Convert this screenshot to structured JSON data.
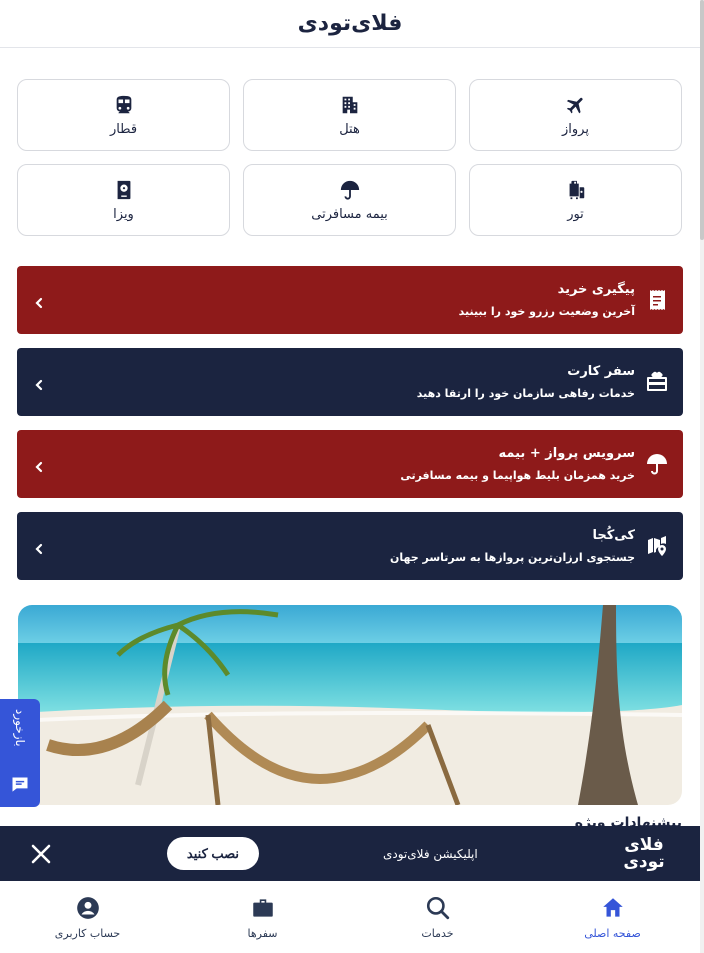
{
  "header": {
    "logo_text": "فلای‌تودی"
  },
  "services": [
    {
      "label": "پرواز",
      "icon": "airplane-icon"
    },
    {
      "label": "هتل",
      "icon": "hotel-building-icon"
    },
    {
      "label": "قطار",
      "icon": "train-icon"
    },
    {
      "label": "تور",
      "icon": "luggage-icon"
    },
    {
      "label": "بیمه مسافرتی",
      "icon": "umbrella-icon"
    },
    {
      "label": "ویزا",
      "icon": "passport-icon"
    }
  ],
  "banners": [
    {
      "title": "پیگیری خرید",
      "subtitle": "آخرین وضعیت رزرو خود را ببینید",
      "icon": "receipt-icon",
      "color": "#8e1a1a"
    },
    {
      "title": "سفر کارت",
      "subtitle": "خدمات رفاهی سازمان خود را ارتقا دهید",
      "icon": "gift-card-icon",
      "color": "#1b2440"
    },
    {
      "title": "سرویس پرواز + بیمه",
      "subtitle": "خرید همزمان بلیط هواپیما و بیمه مسافرتی",
      "icon": "umbrella-icon",
      "color": "#8e1a1a"
    },
    {
      "title": "کی‌کُجا",
      "subtitle": "جستجوی ارزان‌ترین پروازها به سرتاسر جهان",
      "icon": "map-pin-icon",
      "color": "#1b2440"
    }
  ],
  "section": {
    "title": "پیشنهادات ویژه"
  },
  "feedback": {
    "label": "بازخورد"
  },
  "install_bar": {
    "text": "اپلیکیشن فلای‌تودی",
    "button": "نصب کنید",
    "logo_line1": "فلای",
    "logo_line2": "تودی"
  },
  "bottom_nav": [
    {
      "label": "صفحه اصلی",
      "icon": "home-icon",
      "active": true
    },
    {
      "label": "خدمات",
      "icon": "search-icon",
      "active": false
    },
    {
      "label": "سفرها",
      "icon": "briefcase-icon",
      "active": false
    },
    {
      "label": "حساب کاربری",
      "icon": "user-circle-icon",
      "active": false
    }
  ],
  "colors": {
    "navy": "#1b2440",
    "red": "#8e1a1a",
    "accent": "#3555d8"
  }
}
